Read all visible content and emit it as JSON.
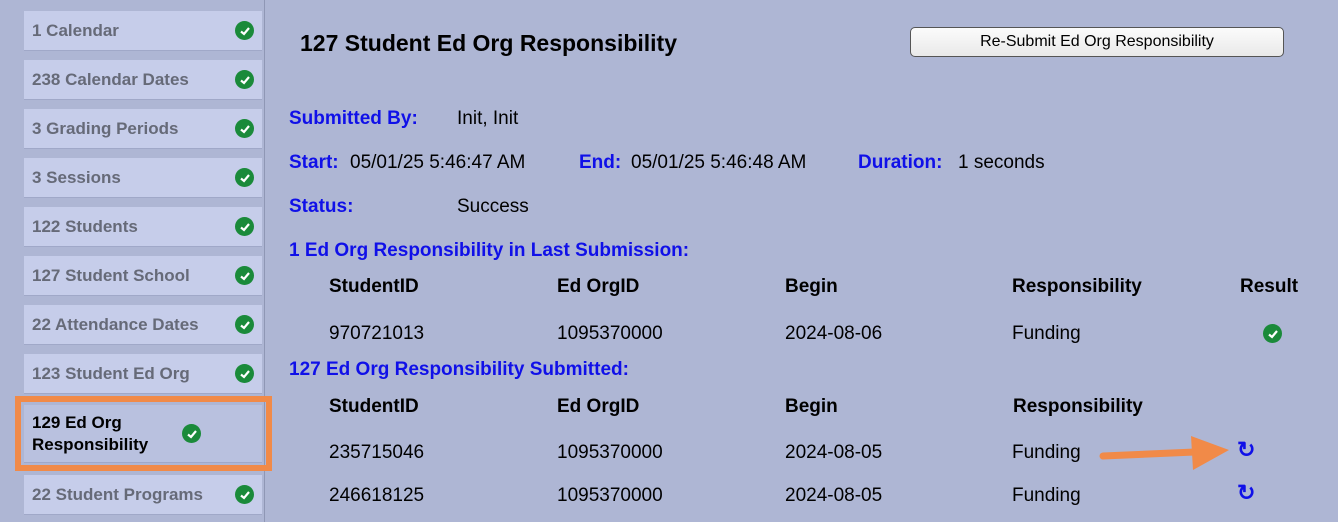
{
  "sidebar": {
    "items": [
      {
        "label": "1 Calendar"
      },
      {
        "label": "238 Calendar Dates"
      },
      {
        "label": "3 Grading Periods"
      },
      {
        "label": "3 Sessions"
      },
      {
        "label": "122 Students"
      },
      {
        "label": "127 Student School"
      },
      {
        "label": "22 Attendance Dates"
      },
      {
        "label": "123 Student Ed Org"
      },
      {
        "label": "129 Ed Org Responsibility"
      },
      {
        "label": "22 Student Programs"
      }
    ]
  },
  "main": {
    "title": "127 Student Ed Org Responsibility",
    "resubmit_label": "Re-Submit Ed Org Responsibility",
    "submitted_by_label": "Submitted By:",
    "submitted_by": "Init, Init",
    "start_label": "Start:",
    "start": "05/01/25 5:46:47 AM",
    "end_label": "End:",
    "end": "05/01/25 5:46:48 AM",
    "duration_label": "Duration:",
    "duration": "1 seconds",
    "status_label": "Status:",
    "status": "Success",
    "last_submission": {
      "heading": "1 Ed Org Responsibility in Last Submission:",
      "columns": [
        "StudentID",
        "Ed OrgID",
        "Begin",
        "Responsibility",
        "Result"
      ],
      "rows": [
        {
          "student_id": "970721013",
          "ed_org_id": "1095370000",
          "begin": "2024-08-06",
          "responsibility": "Funding",
          "result_icon": "check-icon"
        }
      ]
    },
    "submitted": {
      "heading": "127 Ed Org Responsibility Submitted:",
      "columns": [
        "StudentID",
        "Ed OrgID",
        "Begin",
        "Responsibility"
      ],
      "rows": [
        {
          "student_id": "235715046",
          "ed_org_id": "1095370000",
          "begin": "2024-08-05",
          "responsibility": "Funding",
          "action_icon": "refresh-icon"
        },
        {
          "student_id": "246618125",
          "ed_org_id": "1095370000",
          "begin": "2024-08-05",
          "responsibility": "Funding",
          "action_icon": "refresh-icon"
        }
      ]
    }
  },
  "colors": {
    "background": "#aeb6d4",
    "label_blue": "#1010e8",
    "check_green": "#1a8a3a",
    "highlight_orange": "#f18a48"
  }
}
